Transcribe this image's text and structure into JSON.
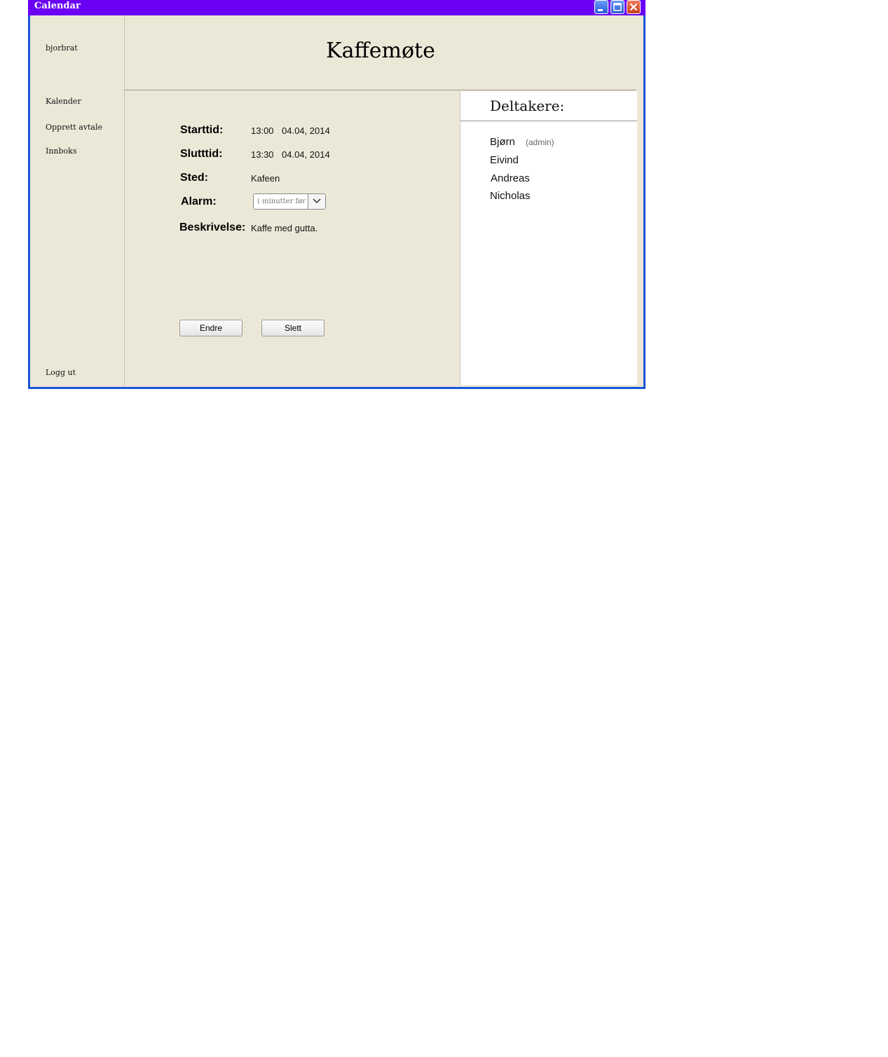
{
  "window": {
    "title": "Calendar"
  },
  "sidebar": {
    "username": "bjorbrat",
    "items": [
      {
        "label": "Kalender"
      },
      {
        "label": "Opprett avtale"
      },
      {
        "label": "Innboks"
      }
    ],
    "logout_label": "Logg ut"
  },
  "event": {
    "title": "Kaffemøte",
    "start_label": "Starttid:",
    "start_time": "13:00",
    "start_date": "04.04, 2014",
    "end_label": "Slutttid:",
    "end_time": "13:30",
    "end_date": "04.04, 2014",
    "place_label": "Sted:",
    "place_value": "Kafeen",
    "alarm_label": "Alarm:",
    "alarm_placeholder": "( minutter før )",
    "description_label": "Beskrivelse:",
    "description_value": "Kaffe med gutta.",
    "edit_button": "Endre",
    "delete_button": "Slett"
  },
  "participants": {
    "title": "Deltakere:",
    "list": [
      {
        "name": "Bjørn",
        "role": "(admin)"
      },
      {
        "name": "Eivind"
      },
      {
        "name": "Andreas"
      },
      {
        "name": "Nicholas"
      }
    ]
  },
  "colors": {
    "titlebar": "#6a00f4",
    "window_border": "#1a55d8",
    "panel_background": "#ece8d8"
  }
}
